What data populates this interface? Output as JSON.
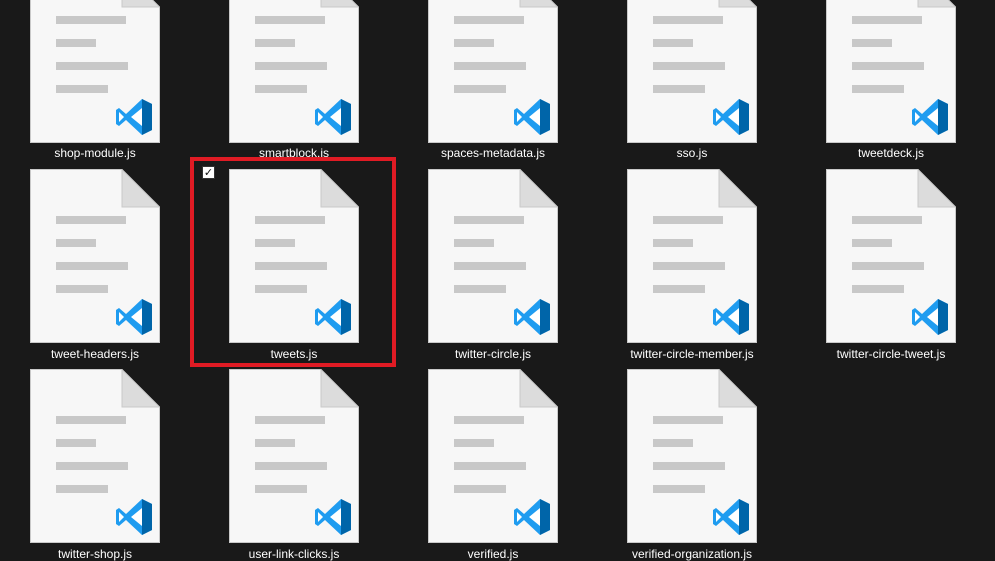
{
  "files": [
    {
      "name": "shop-module.js",
      "selected": false
    },
    {
      "name": "smartblock.js",
      "selected": false
    },
    {
      "name": "spaces-metadata.js",
      "selected": false
    },
    {
      "name": "sso.js",
      "selected": false
    },
    {
      "name": "tweetdeck.js",
      "selected": false
    },
    {
      "name": "tweet-headers.js",
      "selected": false
    },
    {
      "name": "tweets.js",
      "selected": true
    },
    {
      "name": "twitter-circle.js",
      "selected": false
    },
    {
      "name": "twitter-circle-member.js",
      "selected": false
    },
    {
      "name": "twitter-circle-tweet.js",
      "selected": false
    },
    {
      "name": "twitter-shop.js",
      "selected": false
    },
    {
      "name": "user-link-clicks.js",
      "selected": false
    },
    {
      "name": "verified.js",
      "selected": false
    },
    {
      "name": "verified-organization.js",
      "selected": false
    }
  ],
  "file_icon": "vscode-js-file-icon",
  "checkbox_glyph": "✓",
  "colors": {
    "background": "#191919",
    "selection_fill": "#777777",
    "highlight_frame": "#e01b24",
    "vscode_blue": "#0065a9",
    "vscode_light_blue": "#1f9cf0"
  }
}
